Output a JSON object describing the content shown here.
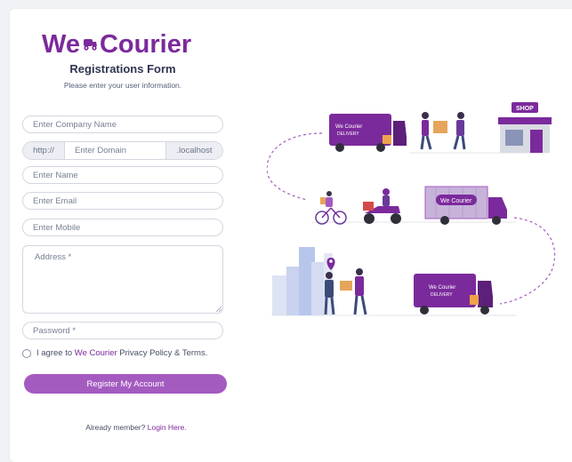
{
  "brand": {
    "logo_prefix": "We",
    "logo_suffix": "Courier",
    "accent": "#7b2a9c",
    "button_color": "#a45bc0"
  },
  "form": {
    "title": "Registrations Form",
    "subtitle": "Please enter your user information.",
    "company_placeholder": "Enter Company Name",
    "domain_prefix": "http://",
    "domain_placeholder": "Enter Domain",
    "domain_suffix": ".localhost",
    "name_placeholder": "Enter Name",
    "email_placeholder": "Enter Email",
    "mobile_placeholder": "Enter Mobile",
    "address_placeholder": "Address *",
    "password_placeholder": "Password *",
    "agree_prefix": "I agree to",
    "agree_brand": "We Courier",
    "agree_suffix": "Privacy Policy & Terms.",
    "register_label": "Register My Account",
    "member_text": "Already member?",
    "login_link": "Login Here."
  },
  "illustration": {
    "truck_label_1": "We Courier",
    "truck_label_1b": "DELIVERY",
    "shop_sign": "SHOP",
    "truck_label_2": "We Courier",
    "truck_label_3": "We Courier",
    "truck_label_3b": "DELIVERY"
  }
}
